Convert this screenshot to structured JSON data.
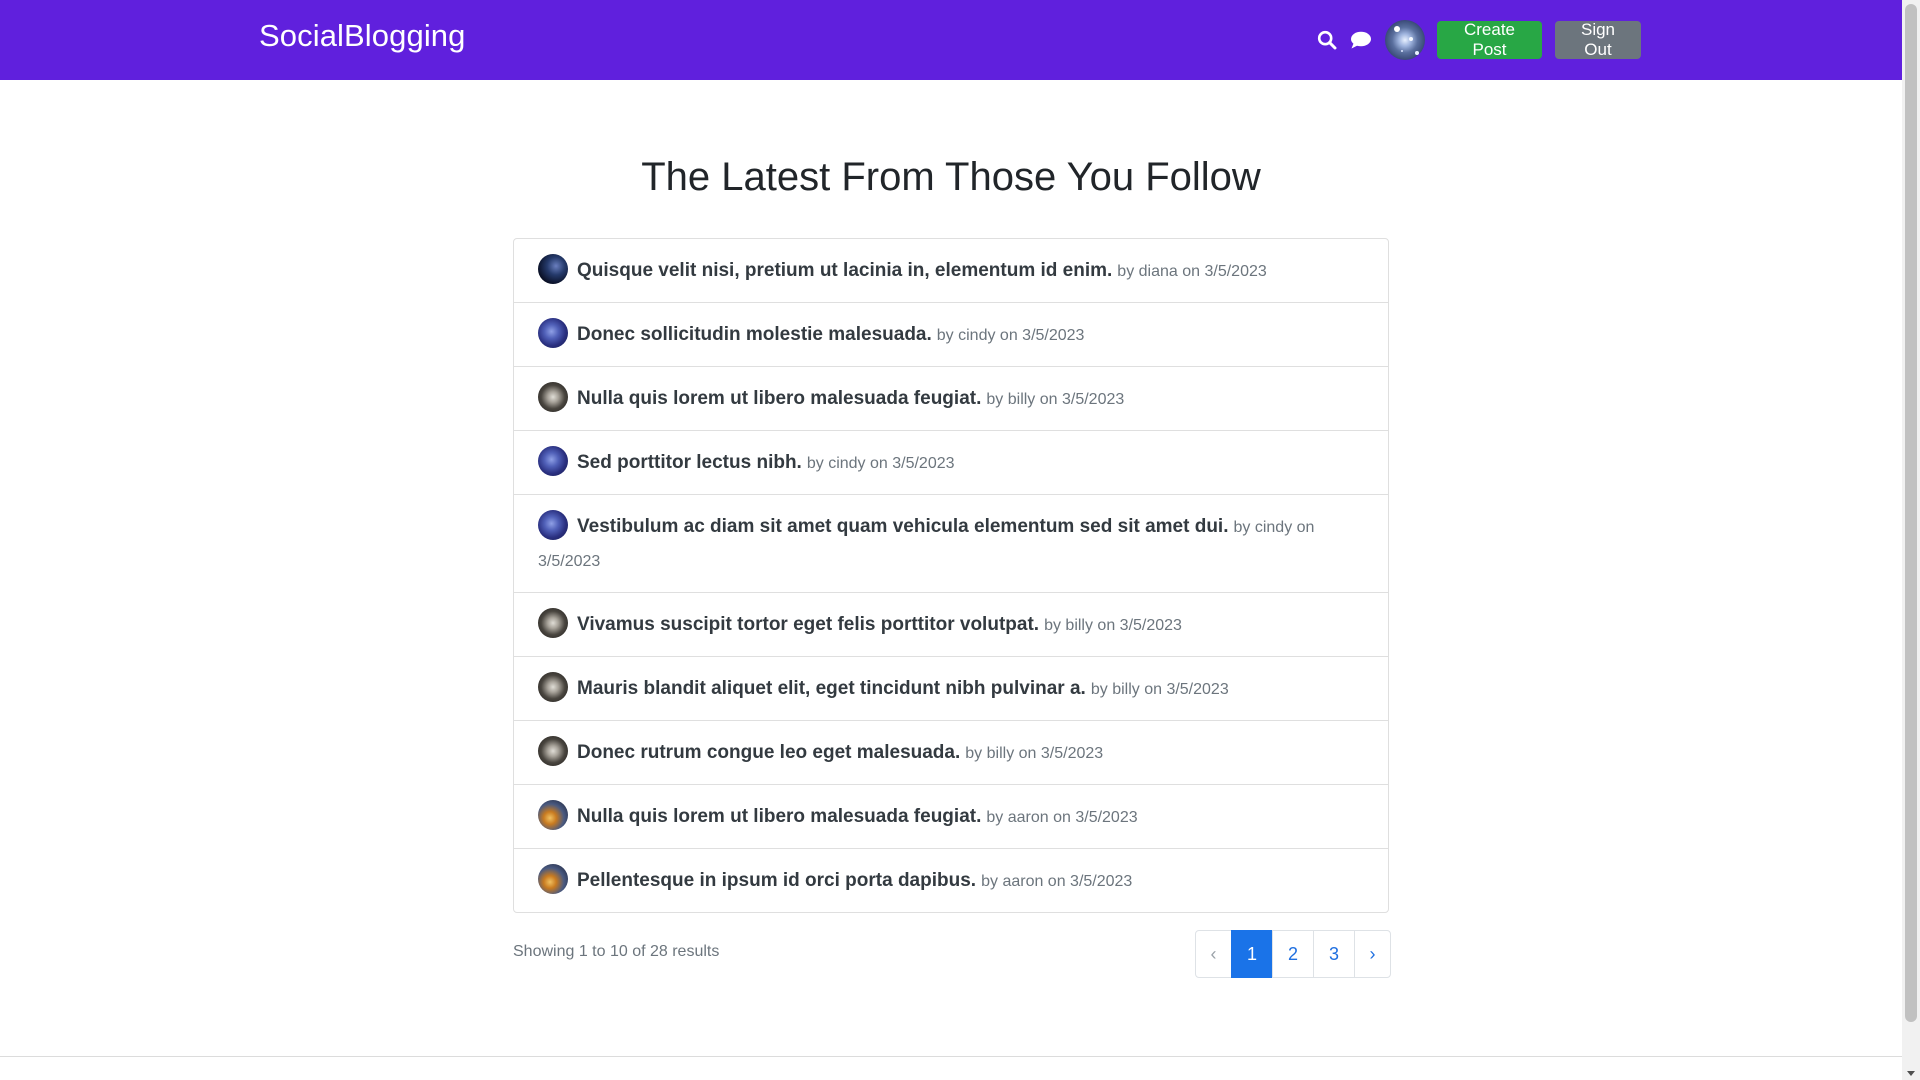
{
  "header": {
    "brand": "SocialBlogging",
    "create_post_label": "Create Post",
    "sign_out_label": "Sign Out",
    "bg_color": "#6020dd"
  },
  "main": {
    "title": "The Latest From Those You Follow",
    "posts": [
      {
        "title": "Quisque velit nisi, pretium ut lacinia in, elementum id enim.",
        "meta": "by diana on 3/5/2023"
      },
      {
        "title": "Donec sollicitudin molestie malesuada.",
        "meta": "by cindy on 3/5/2023"
      },
      {
        "title": "Nulla quis lorem ut libero malesuada feugiat.",
        "meta": "by billy on 3/5/2023"
      },
      {
        "title": "Sed porttitor lectus nibh.",
        "meta": "by cindy on 3/5/2023"
      },
      {
        "title": "Vestibulum ac diam sit amet quam vehicula elementum sed sit amet dui.",
        "meta": "by cindy on 3/5/2023"
      },
      {
        "title": "Vivamus suscipit tortor eget felis porttitor volutpat.",
        "meta": "by billy on 3/5/2023"
      },
      {
        "title": "Mauris blandit aliquet elit, eget tincidunt nibh pulvinar a.",
        "meta": "by billy on 3/5/2023"
      },
      {
        "title": "Donec rutrum congue leo eget malesuada.",
        "meta": "by billy on 3/5/2023"
      },
      {
        "title": "Nulla quis lorem ut libero malesuada feugiat.",
        "meta": "by aaron on 3/5/2023"
      },
      {
        "title": "Pellentesque in ipsum id orci porta dapibus.",
        "meta": "by aaron on 3/5/2023"
      }
    ],
    "results_text": "Showing 1 to 10 of 28 results"
  },
  "pagination": {
    "prev": "‹",
    "pages": [
      "1",
      "2",
      "3"
    ],
    "active": "1",
    "next": "›"
  },
  "colors": {
    "accent": "#6020dd",
    "create_button": "#28a745",
    "sign_out_button": "#6c757d",
    "active_page": "#1a73e8"
  }
}
